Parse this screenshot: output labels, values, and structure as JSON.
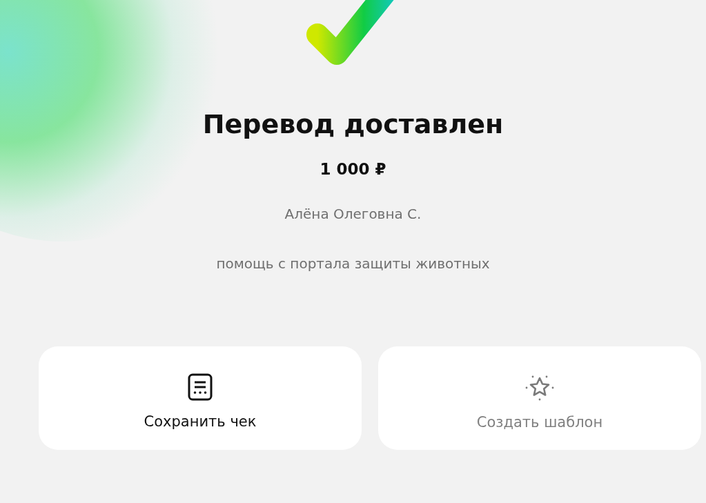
{
  "status": {
    "title": "Перевод доставлен",
    "amount": "1 000 ₽",
    "recipient": "Алёна Олеговна С.",
    "message": "помощь с портала защиты животных"
  },
  "actions": [
    {
      "kind": "receipt",
      "label": "Сохранить чек",
      "disabled": false
    },
    {
      "kind": "template",
      "label": "Создать шаблон",
      "disabled": true
    }
  ]
}
